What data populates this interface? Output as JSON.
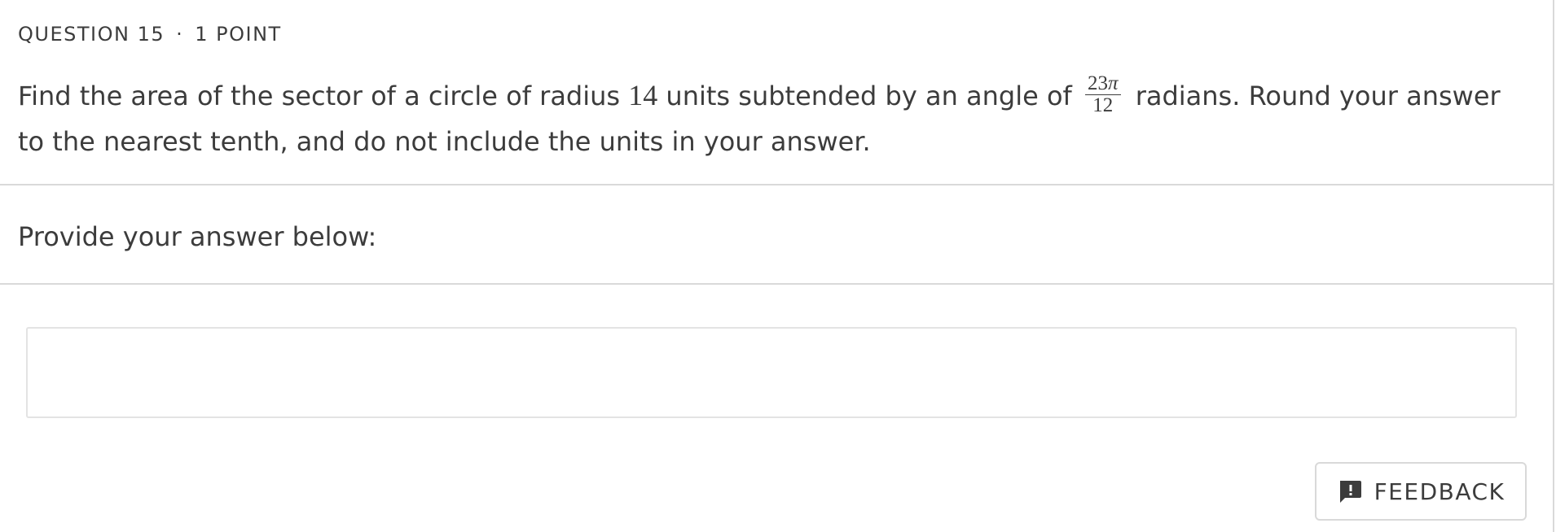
{
  "question": {
    "number_label": "QUESTION 15",
    "separator": "·",
    "points_label": "1 POINT",
    "text_part1": "Find the area of the sector of a circle of radius ",
    "radius": "14",
    "text_part2": " units subtended by an angle of ",
    "angle_numerator": "23",
    "angle_numerator_symbol": "π",
    "angle_denominator": "12",
    "text_part3": " radians. Round your answer to the nearest tenth, and do not include the units in your answer."
  },
  "answer": {
    "prompt": "Provide your answer below:",
    "value": ""
  },
  "feedback": {
    "label": "FEEDBACK",
    "icon": "feedback-icon",
    "icon_glyph": "!"
  },
  "colors": {
    "text": "#3c3c3c",
    "border": "#d9d9d9",
    "background": "#ffffff"
  }
}
